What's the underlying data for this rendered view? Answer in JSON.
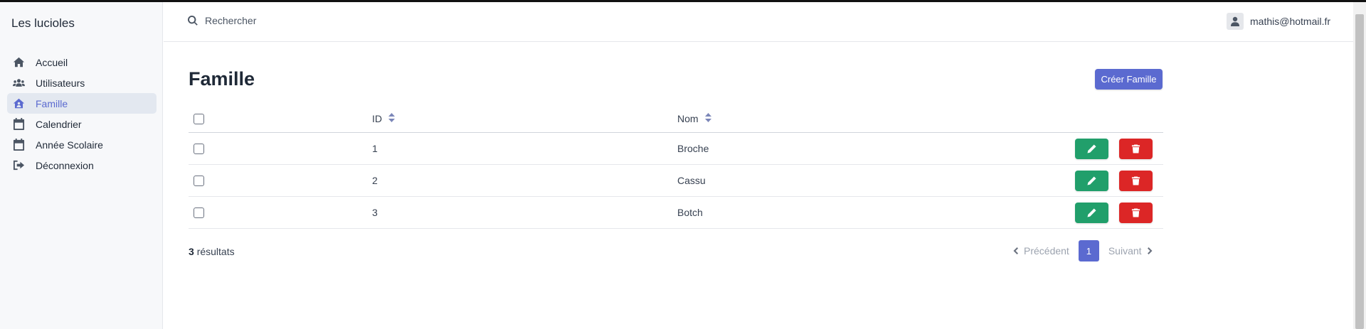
{
  "app": {
    "title": "Les lucioles"
  },
  "sidebar": {
    "items": [
      {
        "label": "Accueil",
        "icon": "home-icon",
        "active": false
      },
      {
        "label": "Utilisateurs",
        "icon": "users-icon",
        "active": false
      },
      {
        "label": "Famille",
        "icon": "house-user-icon",
        "active": true
      },
      {
        "label": "Calendrier",
        "icon": "calendar-icon",
        "active": false
      },
      {
        "label": "Année Scolaire",
        "icon": "calendar-icon",
        "active": false
      },
      {
        "label": "Déconnexion",
        "icon": "sign-out-icon",
        "active": false
      }
    ]
  },
  "topbar": {
    "search": {
      "placeholder": "Rechercher",
      "value": ""
    },
    "user": {
      "email": "mathis@hotmail.fr",
      "icon": "user-icon"
    }
  },
  "page": {
    "title": "Famille",
    "create_label": "Créer Famille"
  },
  "table": {
    "columns": [
      {
        "label": "ID",
        "sortable": true
      },
      {
        "label": "Nom",
        "sortable": true
      }
    ],
    "rows": [
      {
        "id": "1",
        "nom": "Broche"
      },
      {
        "id": "2",
        "nom": "Cassu"
      },
      {
        "id": "3",
        "nom": "Botch"
      }
    ]
  },
  "footer": {
    "count": "3",
    "results_label": "résultats"
  },
  "pagination": {
    "prev": "Précédent",
    "current": "1",
    "next": "Suivant"
  },
  "colors": {
    "accent": "#5b6ad0",
    "edit": "#219f6b",
    "delete": "#dc2626",
    "sidebar_bg": "#f7f8fa",
    "active_bg": "#e3e8f0"
  }
}
